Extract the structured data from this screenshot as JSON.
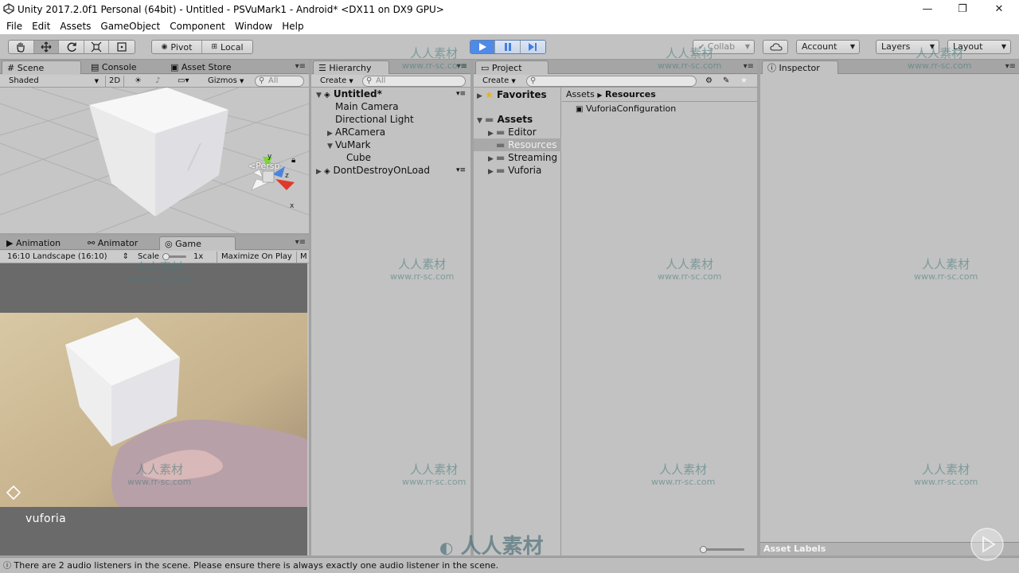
{
  "window": {
    "title": "Unity 2017.2.0f1 Personal (64bit) - Untitled - PSVuMark1 - Android* <DX11 on DX9 GPU>",
    "minimize_glyph": "—",
    "maximize_glyph": "❐",
    "close_glyph": "✕"
  },
  "menu": [
    "File",
    "Edit",
    "Assets",
    "GameObject",
    "Component",
    "Window",
    "Help"
  ],
  "toolbar": {
    "pivot_label": "Pivot",
    "local_label": "Local",
    "collab_label": "Collab",
    "account_label": "Account",
    "layers_label": "Layers",
    "layout_label": "Layout",
    "play_state": "playing",
    "accent": "#3f7fe0"
  },
  "scene": {
    "tabs": [
      "Scene",
      "Console",
      "Asset Store"
    ],
    "shading_mode": "Shaded",
    "mode_2d": "2D",
    "gizmos_label": "Gizmos",
    "search_placeholder": "All",
    "gizmo_axes": [
      "y",
      "z",
      "x"
    ],
    "projection_label": "Persp"
  },
  "game": {
    "tabs": [
      "Animation",
      "Animator",
      "Game"
    ],
    "aspect": "16:10 Landscape (16:10)",
    "scale_label": "Scale",
    "scale_value": "1x",
    "maximize_label": "Maximize On Play",
    "extra_label": "M",
    "vuforia_label": "vuforia"
  },
  "hierarchy": {
    "tab": "Hierarchy",
    "create_label": "Create",
    "search_placeholder": "All",
    "scene_name": "Untitled*",
    "items": [
      "Main Camera",
      "Directional Light",
      "ARCamera",
      "VuMark",
      "Cube"
    ],
    "dont_destroy": "DontDestroyOnLoad"
  },
  "project": {
    "tab": "Project",
    "create_label": "Create",
    "favorites": "Favorites",
    "assets": "Assets",
    "folders": [
      "Editor",
      "Resources",
      "Streaming",
      "Vuforia"
    ],
    "selected_folder": "Resources",
    "breadcrumb": [
      "Assets",
      "Resources"
    ],
    "files": [
      "VuforiaConfiguration"
    ]
  },
  "inspector": {
    "tab": "Inspector",
    "asset_labels": "Asset Labels"
  },
  "status": {
    "message": "There are 2 audio listeners in the scene. Please ensure there is always exactly one audio listener in the scene."
  },
  "watermark": {
    "text": "人人素材",
    "url": "www.rr-sc.com",
    "banner": "人人素材"
  }
}
